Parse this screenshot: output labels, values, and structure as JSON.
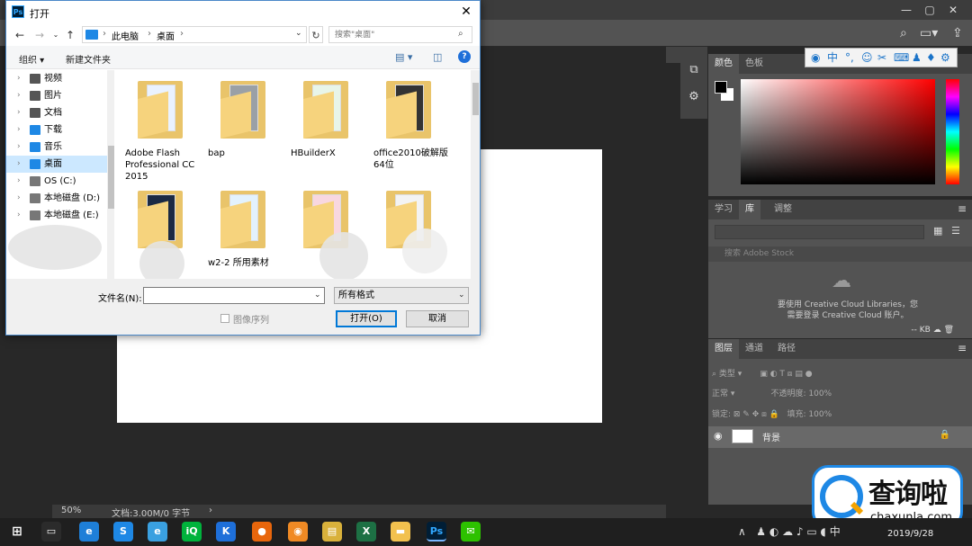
{
  "photoshop": {
    "zoom": "50%",
    "doc_info": "文档:3.00M/0 字节",
    "color_tabs": [
      "颜色",
      "色板"
    ],
    "library_tabs": [
      "学习",
      "库",
      "调整"
    ],
    "library_search_placeholder": "搜索 Adobe Stock",
    "library_message_line1": "要使用 Creative Cloud Libraries，您",
    "library_message_line2": "需要登录 Creative Cloud 账户。",
    "library_footer": "-- KB",
    "layers_tabs": [
      "图层",
      "通道",
      "路径"
    ],
    "layers_filter": "类型",
    "blend_mode": "正常",
    "opacity_label": "不透明度:",
    "opacity_value": "100%",
    "lock_label": "锁定:",
    "fill_label": "填充:",
    "fill_value": "100%",
    "layer_name": "背景"
  },
  "ime": {
    "items": [
      "中",
      "°,",
      "☺",
      "⌨"
    ]
  },
  "dialog": {
    "title": "打开",
    "breadcrumb": [
      "此电脑",
      "桌面"
    ],
    "search_placeholder": "搜索\"桌面\"",
    "organize_label": "组织 ▾",
    "new_folder_label": "新建文件夹",
    "nav_items": [
      {
        "label": "视频",
        "color": "#555555"
      },
      {
        "label": "图片",
        "color": "#555555"
      },
      {
        "label": "文档",
        "color": "#555555"
      },
      {
        "label": "下载",
        "color": "#1e88e5"
      },
      {
        "label": "音乐",
        "color": "#1e88e5"
      },
      {
        "label": "桌面",
        "color": "#1e88e5"
      },
      {
        "label": "OS (C:)",
        "color": "#777777"
      },
      {
        "label": "本地磁盘 (D:)",
        "color": "#777777"
      },
      {
        "label": "本地磁盘 (E:)",
        "color": "#777777"
      }
    ],
    "selected_nav": "桌面",
    "files": [
      {
        "label": "Adobe Flash Professional CC 2015"
      },
      {
        "label": "bap"
      },
      {
        "label": "HBuilderX"
      },
      {
        "label": "office2010破解版 64位"
      },
      {
        "label": ""
      },
      {
        "label": "w2-2 所用素材"
      },
      {
        "label": ""
      },
      {
        "label": ""
      }
    ],
    "filename_label": "文件名(N):",
    "filename_value": "",
    "format_value": "所有格式",
    "image_sequence_label": "图像序列",
    "open_button": "打开(O)",
    "cancel_button": "取消"
  },
  "watermark": {
    "title": "查询啦",
    "domain": "chaxunla.com"
  },
  "taskbar": {
    "clock": "2019/9/28",
    "ime_indicator": "中",
    "apps": [
      {
        "name": "task-view",
        "color": "#2b2b2b",
        "glyph": "▭"
      },
      {
        "name": "ie",
        "color": "#1e7fd8",
        "glyph": "e"
      },
      {
        "name": "sogou",
        "color": "#1e88e5",
        "glyph": "S"
      },
      {
        "name": "ie2",
        "color": "#3aa0e0",
        "glyph": "e"
      },
      {
        "name": "iqiyi",
        "color": "#00b33c",
        "glyph": "iQ"
      },
      {
        "name": "kugou",
        "color": "#1e6fd9",
        "glyph": "K"
      },
      {
        "name": "firefox",
        "color": "#e8660c",
        "glyph": "●"
      },
      {
        "name": "browser",
        "color": "#f08a24",
        "glyph": "◉"
      },
      {
        "name": "notes",
        "color": "#d9b13b",
        "glyph": "▤"
      },
      {
        "name": "excel",
        "color": "#1d7044",
        "glyph": "X"
      },
      {
        "name": "explorer",
        "color": "#f2c14e",
        "glyph": "▬"
      },
      {
        "name": "photoshop",
        "color": "#001e36",
        "glyph": "Ps"
      },
      {
        "name": "wechat",
        "color": "#2dc100",
        "glyph": "✉"
      }
    ]
  }
}
